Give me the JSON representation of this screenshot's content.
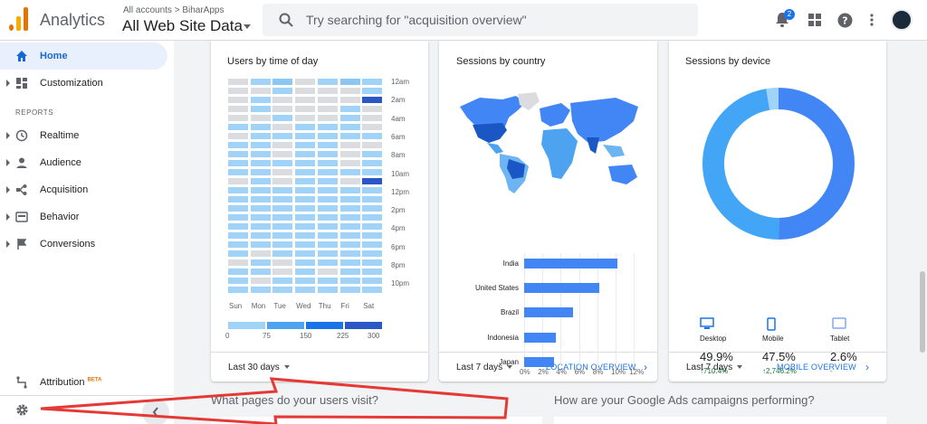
{
  "header": {
    "app_name": "Analytics",
    "account_crumb": "All accounts > BiharApps",
    "view_name": "All Web Site Data",
    "search_placeholder": "Try searching for \"acquisition overview\"",
    "notification_count": "2"
  },
  "sidebar": {
    "items": [
      {
        "label": "Home",
        "icon": "home-icon"
      },
      {
        "label": "Customization",
        "icon": "dashboard-icon"
      },
      {
        "label": "Realtime",
        "icon": "clock-icon"
      },
      {
        "label": "Audience",
        "icon": "person-icon"
      },
      {
        "label": "Acquisition",
        "icon": "acquisition-icon"
      },
      {
        "label": "Behavior",
        "icon": "behavior-icon"
      },
      {
        "label": "Conversions",
        "icon": "flag-icon"
      }
    ],
    "reports_header": "REPORTS",
    "attribution_label": "Attribution",
    "attribution_badge": "BETA"
  },
  "cards": {
    "time": {
      "title": "Users by time of day",
      "range": "Last 30 days",
      "hours": [
        "12am",
        "2am",
        "4am",
        "6am",
        "8am",
        "10am",
        "12pm",
        "2pm",
        "4pm",
        "6pm",
        "8pm",
        "10pm"
      ],
      "days": [
        "Sun",
        "Mon",
        "Tue",
        "Wed",
        "Thu",
        "Fri",
        "Sat"
      ],
      "scale": [
        "0",
        "75",
        "150",
        "225",
        "300"
      ]
    },
    "country": {
      "title": "Sessions by country",
      "range": "Last 7 days",
      "link": "LOCATION OVERVIEW"
    },
    "device": {
      "title": "Sessions by device",
      "range": "Last 7 days",
      "link": "MOBILE OVERVIEW",
      "devices": [
        {
          "name": "Desktop",
          "pct": "49.9%",
          "change": "↑710.4%"
        },
        {
          "name": "Mobile",
          "pct": "47.5%",
          "change": "↑2,746.2%"
        },
        {
          "name": "Tablet",
          "pct": "2.6%",
          "change": "-"
        }
      ]
    }
  },
  "chart_data": [
    {
      "type": "heatmap",
      "title": "Users by time of day",
      "x": [
        "Sun",
        "Mon",
        "Tue",
        "Wed",
        "Thu",
        "Fri",
        "Sat"
      ],
      "y": [
        "12am",
        "2am",
        "4am",
        "6am",
        "8am",
        "10am",
        "12pm",
        "2pm",
        "4pm",
        "6pm",
        "8pm",
        "10pm"
      ],
      "color_scale": [
        0,
        300
      ],
      "legend_ticks": [
        "0",
        "75",
        "150",
        "225",
        "300"
      ]
    },
    {
      "type": "bar",
      "title": "Sessions by country",
      "categories": [
        "India",
        "United States",
        "Brazil",
        "Indonesia",
        "Japan"
      ],
      "values": [
        10.2,
        8.2,
        5.3,
        3.5,
        3.3
      ],
      "x_ticks": [
        "0%",
        "2%",
        "4%",
        "6%",
        "8%",
        "10%",
        "12%"
      ],
      "xlim": [
        0,
        12
      ],
      "orientation": "horizontal",
      "grid": true
    },
    {
      "type": "pie",
      "title": "Sessions by device",
      "categories": [
        "Desktop",
        "Mobile",
        "Tablet"
      ],
      "values": [
        49.9,
        47.5,
        2.6
      ],
      "colors": [
        "#4285f4",
        "#42a5f5",
        "#a1d2f7"
      ],
      "donut": true
    }
  ],
  "bottom": {
    "q1": "What pages do your users visit?",
    "q2": "How are your Google Ads campaigns performing?"
  }
}
